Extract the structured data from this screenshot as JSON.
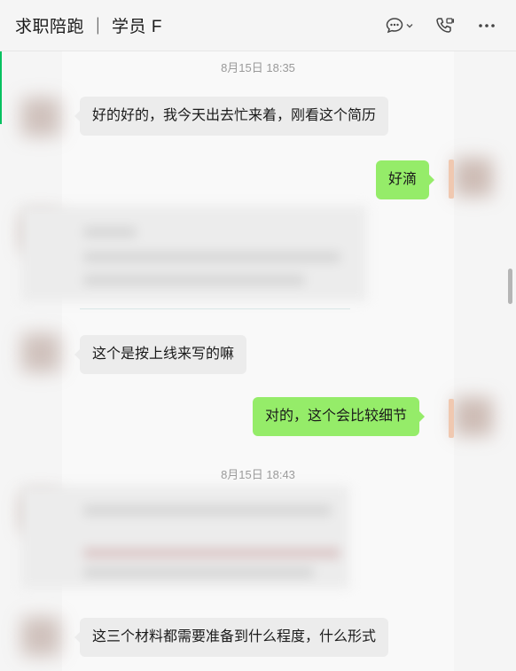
{
  "window": {
    "title": "求职陪跑 ｜ 学员 F"
  },
  "header": {
    "icons": [
      "chat-bubble-icon",
      "chevron-down-icon",
      "phone-icon",
      "more-icon"
    ]
  },
  "messages": [
    {
      "type": "timestamp",
      "text": "8月15日 18:35"
    },
    {
      "type": "incoming",
      "text": "好的好的，我今天出去忙来着，刚看这个简历"
    },
    {
      "type": "outgoing",
      "text": "好滴"
    },
    {
      "type": "incoming-blurred-card"
    },
    {
      "type": "incoming",
      "text": "这个是按上线来写的嘛"
    },
    {
      "type": "outgoing",
      "text": "对的，这个会比较细节"
    },
    {
      "type": "timestamp",
      "text": "8月15日 18:43"
    },
    {
      "type": "incoming-blurred-card"
    },
    {
      "type": "incoming",
      "text": "这三个材料都需要准备到什么程度，什么形式"
    }
  ],
  "colors": {
    "outgoing_bubble": "#95ec69",
    "incoming_bubble": "#ececec",
    "accent": "#07c160"
  }
}
